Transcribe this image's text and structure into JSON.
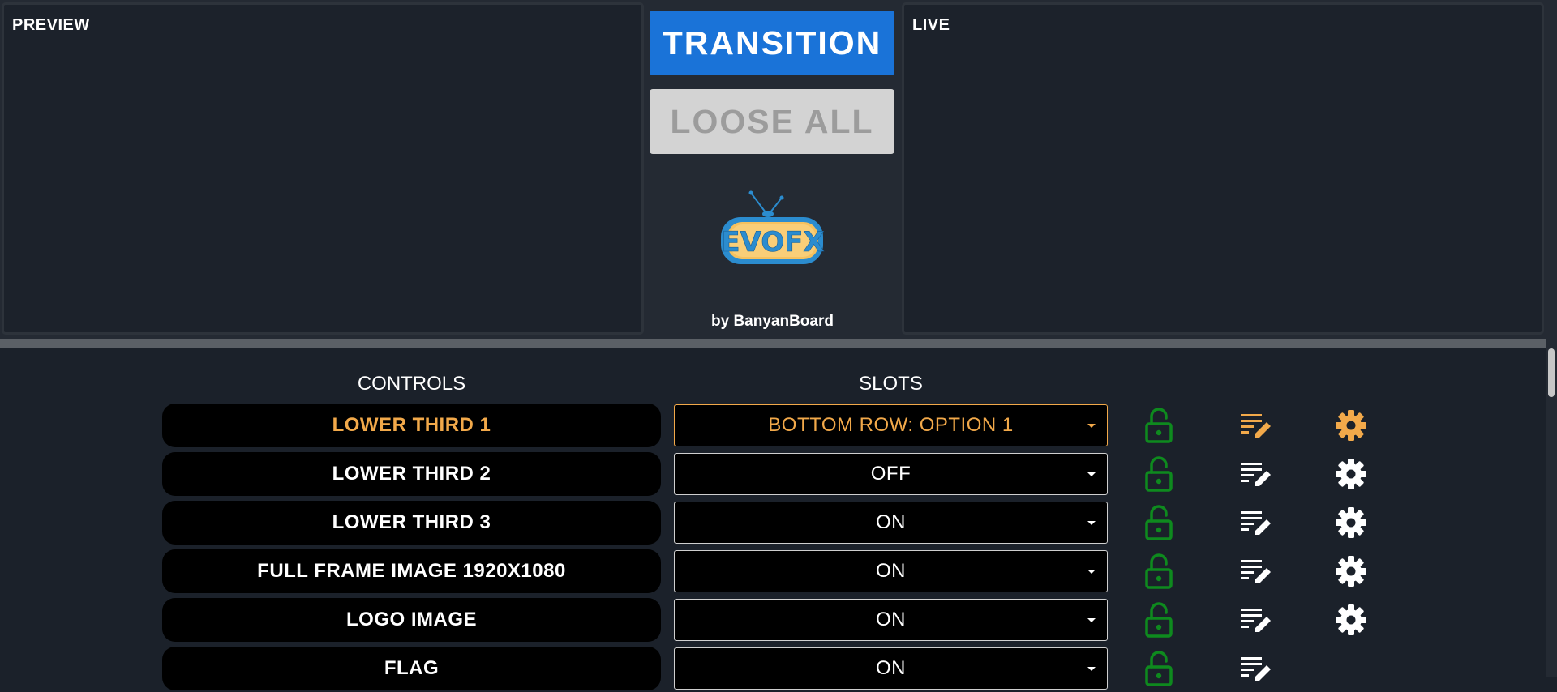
{
  "monitors": {
    "preview_label": "PREVIEW",
    "live_label": "LIVE"
  },
  "center": {
    "transition_label": "TRANSITION",
    "loose_all_label": "LOOSE ALL",
    "logo_text": "EVOFX",
    "byline": "by BanyanBoard"
  },
  "table": {
    "controls_header": "CONTROLS",
    "slots_header": "SLOTS",
    "rows": [
      {
        "control": "LOWER THIRD 1",
        "slot": "BOTTOM ROW: OPTION 1",
        "active": true,
        "has_settings": true
      },
      {
        "control": "LOWER THIRD 2",
        "slot": "OFF",
        "active": false,
        "has_settings": true
      },
      {
        "control": "LOWER THIRD 3",
        "slot": "ON",
        "active": false,
        "has_settings": true
      },
      {
        "control": "FULL FRAME IMAGE 1920X1080",
        "slot": "ON",
        "active": false,
        "has_settings": true
      },
      {
        "control": "LOGO IMAGE",
        "slot": "ON",
        "active": false,
        "has_settings": true
      },
      {
        "control": "FLAG",
        "slot": "ON",
        "active": false,
        "has_settings": false
      }
    ]
  },
  "colors": {
    "accent": "#f2a94a",
    "transition_blue": "#1a73d8",
    "lock_green": "#0e8a1e",
    "background": "#1b212a"
  },
  "icons": {
    "lock": "lock-open-icon",
    "edit": "edit-list-icon",
    "settings": "gear-icon"
  }
}
